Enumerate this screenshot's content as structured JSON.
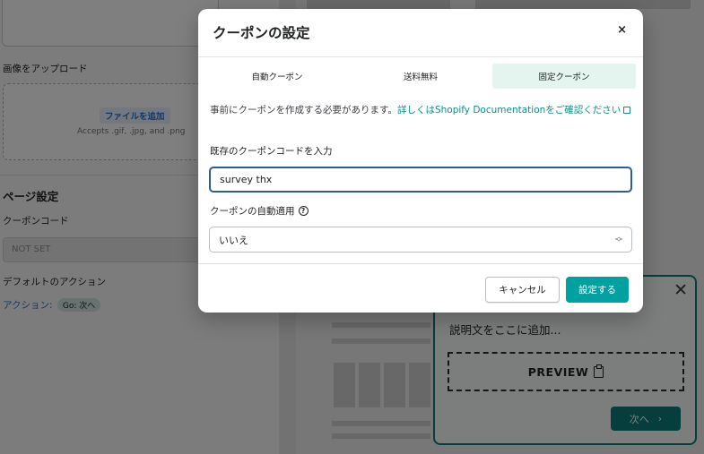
{
  "background": {
    "upload_label": "画像をアップロード",
    "add_file_label": "ファイルを追加",
    "accepts_text": "Accepts .gif, .jpg, and .png",
    "page_settings_title": "ページ設定",
    "coupon_code_label": "クーポンコード",
    "coupon_code_value": "NOT SET",
    "default_action_label": "デフォルトのアクション",
    "action_prefix": "アクション:",
    "action_badge": "Go: 次へ"
  },
  "preview_card": {
    "description": "説明文をここに追加...",
    "preview_label": "PREVIEW",
    "next_label": "次へ",
    "close_glyph": "✕",
    "next_glyph": "›"
  },
  "modal": {
    "title": "クーポンの設定",
    "close_glyph": "×",
    "tabs": [
      {
        "label": "自動クーポン",
        "active": false
      },
      {
        "label": "送料無料",
        "active": false
      },
      {
        "label": "固定クーポン",
        "active": true
      }
    ],
    "notice_text": "事前にクーポンを作成する必要があります。",
    "notice_link": "詳しくはShopify Documentationをご確認ください",
    "existing_code_label": "既存のクーポンコードを入力",
    "existing_code_value": "survey thx",
    "auto_apply_label": "クーポンの自動適用",
    "help_glyph": "?",
    "auto_apply_value": "いいえ",
    "cancel_label": "キャンセル",
    "save_label": "設定する"
  },
  "colors": {
    "accent": "#00a1a0",
    "link": "#0c8f86",
    "active_tab_bg": "#e4f5f0",
    "focus_border": "#2e5b9a"
  },
  "icons": {
    "close": "close-icon",
    "external_link": "external-link-icon",
    "help": "help-icon",
    "select_arrows": "updown-chevron-icon",
    "clipboard": "clipboard-icon"
  }
}
